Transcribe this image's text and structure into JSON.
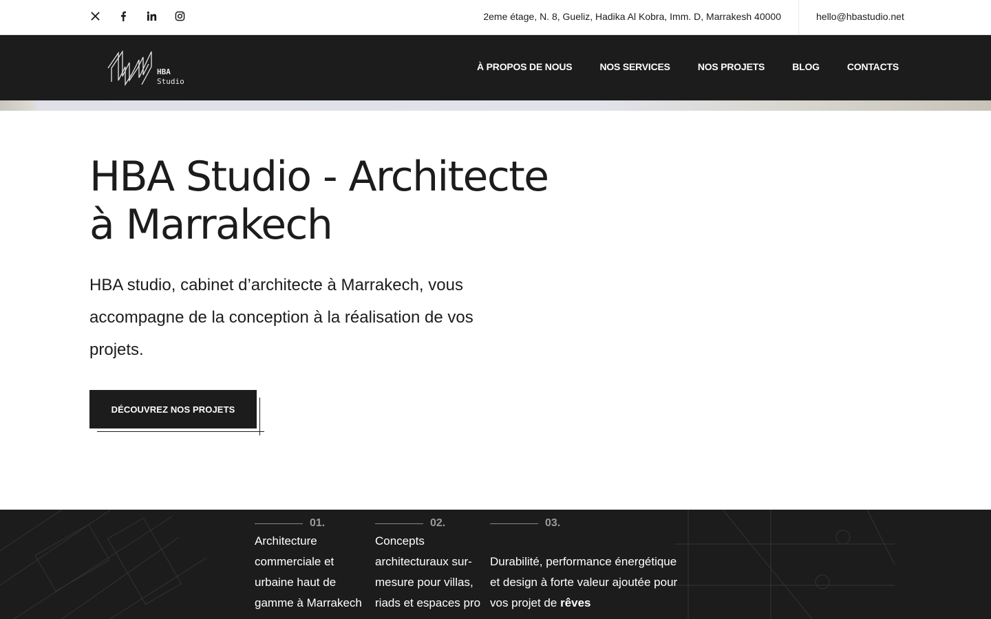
{
  "topbar": {
    "social": [
      {
        "icon": "x-twitter-icon",
        "label": "X"
      },
      {
        "icon": "facebook-icon",
        "label": "Facebook"
      },
      {
        "icon": "linkedin-icon",
        "label": "LinkedIn"
      },
      {
        "icon": "instagram-icon",
        "label": "Instagram"
      }
    ],
    "address": "2eme étage, N. 8, Gueliz, Hadika Al Kobra, Imm. D, Marrakesh 40000",
    "email": "hello@hbastudio.net"
  },
  "navbar": {
    "logo_line1": "HBA",
    "logo_line2": "Studio",
    "items": [
      "À PROPOS DE NOUS",
      "NOS SERVICES",
      "NOS PROJETS",
      "BLOG",
      "CONTACTS"
    ]
  },
  "hero": {
    "title_line1": "HBA Studio - Architecte",
    "title_line2": "à Marrakech",
    "text": "HBA studio, cabinet d’architecte à Marrakech, vous accompagne de la conception à la réalisation de vos projets.",
    "cta": "DÉCOUVREZ NOS PROJETS"
  },
  "features": [
    {
      "num": "01.",
      "text": "Architecture commerciale et urbaine haut de gamme à Marrakech"
    },
    {
      "num": "02.",
      "text": "Concepts architecturaux sur-mesure pour villas, riads et espaces pro"
    },
    {
      "num": "03.",
      "text_before": "Durabilité, performance énergétique et design à forte valeur ajoutée pour vos projet de",
      "text_bold": "rêves"
    }
  ],
  "colors": {
    "dark": "#1c1c1c",
    "muted_number": "#9a9a9a",
    "white": "#ffffff"
  }
}
